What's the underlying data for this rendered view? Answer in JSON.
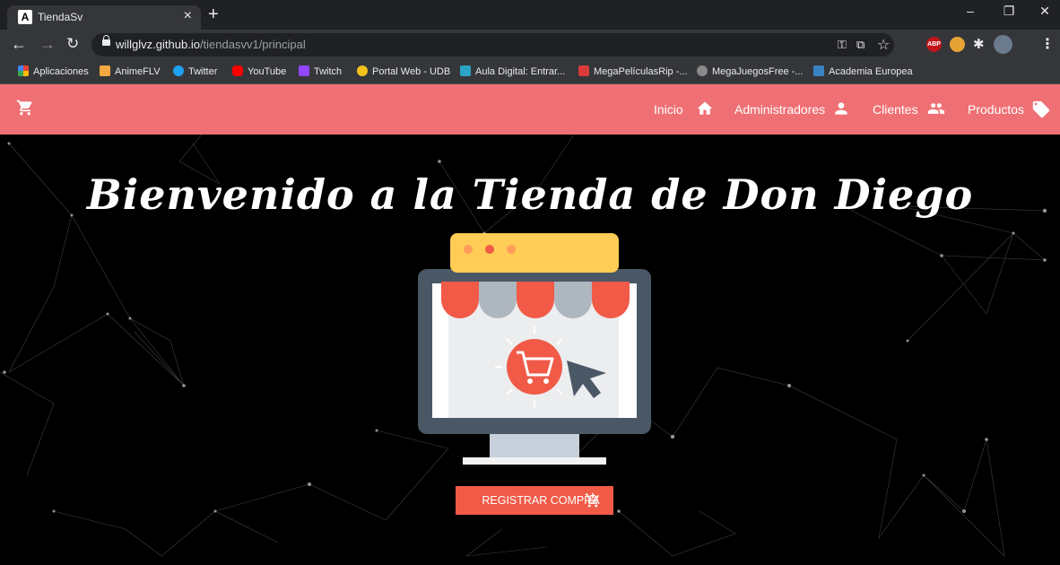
{
  "browser": {
    "tab_title": "TiendaSv",
    "tab_favicon": "A",
    "url_host": "willglvz.github.io",
    "url_path": "/tiendasvv1/principal",
    "bookmarks": [
      {
        "label": "Aplicaciones",
        "icon": "apps-grid-icon",
        "color": "#4285f4"
      },
      {
        "label": "AnimeFLV",
        "icon": "animeflv-icon",
        "color": "#f3a93f"
      },
      {
        "label": "Twitter",
        "icon": "twitter-icon",
        "color": "#1da1f2"
      },
      {
        "label": "YouTube",
        "icon": "youtube-icon",
        "color": "#ff0000"
      },
      {
        "label": "Twitch",
        "icon": "twitch-icon",
        "color": "#9146ff"
      },
      {
        "label": "Portal Web - UDB",
        "icon": "udb-icon",
        "color": "#f2c21a"
      },
      {
        "label": "Aula Digital: Entrar...",
        "icon": "aula-digital-icon",
        "color": "#2aa3c4"
      },
      {
        "label": "MegaPelículasRip -...",
        "icon": "megapeliculas-icon",
        "color": "#d93a3a"
      },
      {
        "label": "MegaJuegosFree -...",
        "icon": "megajuegos-icon",
        "color": "#8a8a8a"
      },
      {
        "label": "Academia Europea",
        "icon": "academia-icon",
        "color": "#3b82c4"
      }
    ],
    "extensions": [
      {
        "label": "ABP",
        "color": "#c0141b"
      },
      {
        "label": "",
        "color": "#e6a335"
      }
    ]
  },
  "site": {
    "accent": "#ef7074",
    "nav": [
      {
        "label": "Inicio",
        "icon": "home-icon"
      },
      {
        "label": "Administradores",
        "icon": "user-icon"
      },
      {
        "label": "Clientes",
        "icon": "users-icon"
      },
      {
        "label": "Productos",
        "icon": "tag-icon"
      }
    ],
    "hero_title": "Bienvenido a la Tienda de Don Diego",
    "cta_label": "REGISTRAR COMPRA",
    "cta_color": "#f05a47"
  }
}
